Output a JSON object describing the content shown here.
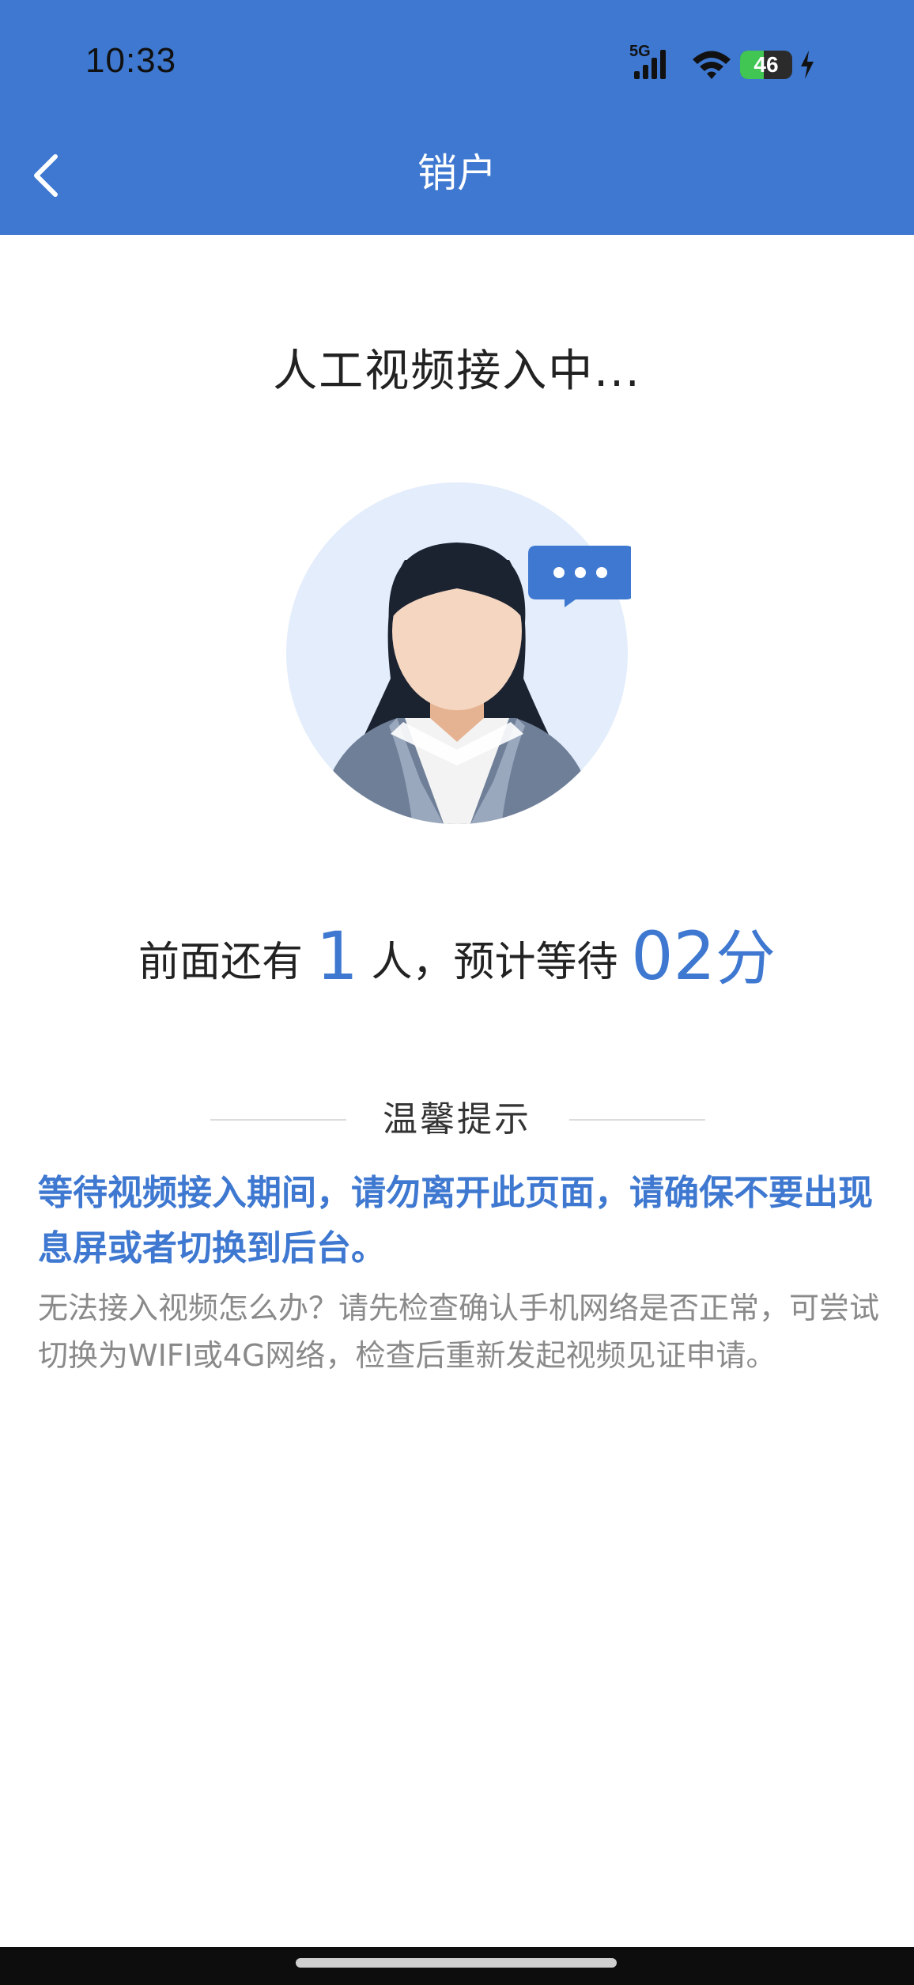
{
  "status_bar": {
    "time": "10:33",
    "network_label": "5G",
    "battery_level": "46",
    "battery_fraction": 0.46
  },
  "nav": {
    "title": "销户",
    "back_icon": "chevron-left-icon"
  },
  "main": {
    "waiting_title": "人工视频接入中...",
    "queue_prefix": "前面还有",
    "queue_count": "1",
    "queue_middle": "人，预计等待",
    "wait_minutes": "02",
    "wait_unit": "分"
  },
  "tips": {
    "title": "温馨提示",
    "main_text": "等待视频接入期间，请勿离开此页面，请确保不要出现息屏或者切换到后台。",
    "sub_text": "无法接入视频怎么办？请先检查确认手机网络是否正常，可尝试切换为WIFI或4G网络，检查后重新发起视频见证申请。"
  },
  "colors": {
    "brand": "#3e78d0",
    "battery_green": "#41c553"
  }
}
